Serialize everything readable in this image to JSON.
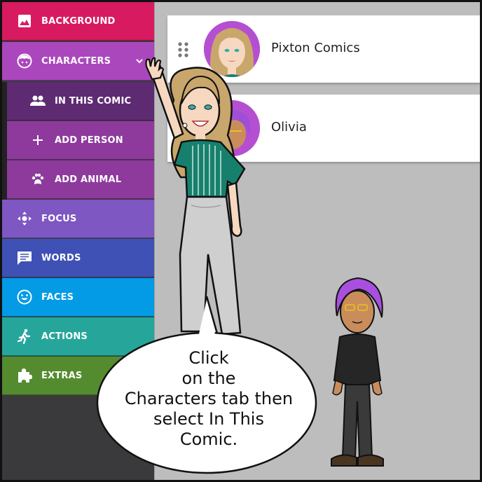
{
  "sidebar": {
    "items": [
      {
        "id": "background",
        "label": "BACKGROUND",
        "icon": "image-icon",
        "color": "#d81b60"
      },
      {
        "id": "characters",
        "label": "CHARACTERS",
        "icon": "face-icon",
        "color": "#ab47bc",
        "expanded": true
      },
      {
        "id": "in-this-comic",
        "label": "IN THIS COMIC",
        "icon": "people-icon",
        "color": "#5e2b73",
        "selected": true
      },
      {
        "id": "add-person",
        "label": "ADD PERSON",
        "icon": "plus-icon",
        "color": "#8e3a9d"
      },
      {
        "id": "add-animal",
        "label": "ADD ANIMAL",
        "icon": "paw-icon",
        "color": "#8e3a9d"
      },
      {
        "id": "focus",
        "label": "FOCUS",
        "icon": "move-icon",
        "color": "#7e57c2"
      },
      {
        "id": "words",
        "label": "WORDS",
        "icon": "speech-bubble-icon",
        "color": "#3f51b5"
      },
      {
        "id": "faces",
        "label": "FACES",
        "icon": "smiley-icon",
        "color": "#039be5"
      },
      {
        "id": "actions",
        "label": "ACTIONS",
        "icon": "running-person-icon",
        "color": "#26a69a"
      },
      {
        "id": "extras",
        "label": "EXTRAS",
        "icon": "puzzle-icon",
        "color": "#558b2f"
      }
    ]
  },
  "characters_list": [
    {
      "name": "Pixton Comics",
      "avatar": "blonde-woman-avatar"
    },
    {
      "name": "Olivia",
      "avatar": "purple-hair-avatar"
    }
  ],
  "speech_bubble": {
    "lines": [
      "Click",
      "on the",
      "Characters tab then",
      "select In This",
      "Comic."
    ]
  },
  "colors": {
    "content_bg": "#bdbdbd",
    "sidebar_bg": "#3a3a3c"
  }
}
